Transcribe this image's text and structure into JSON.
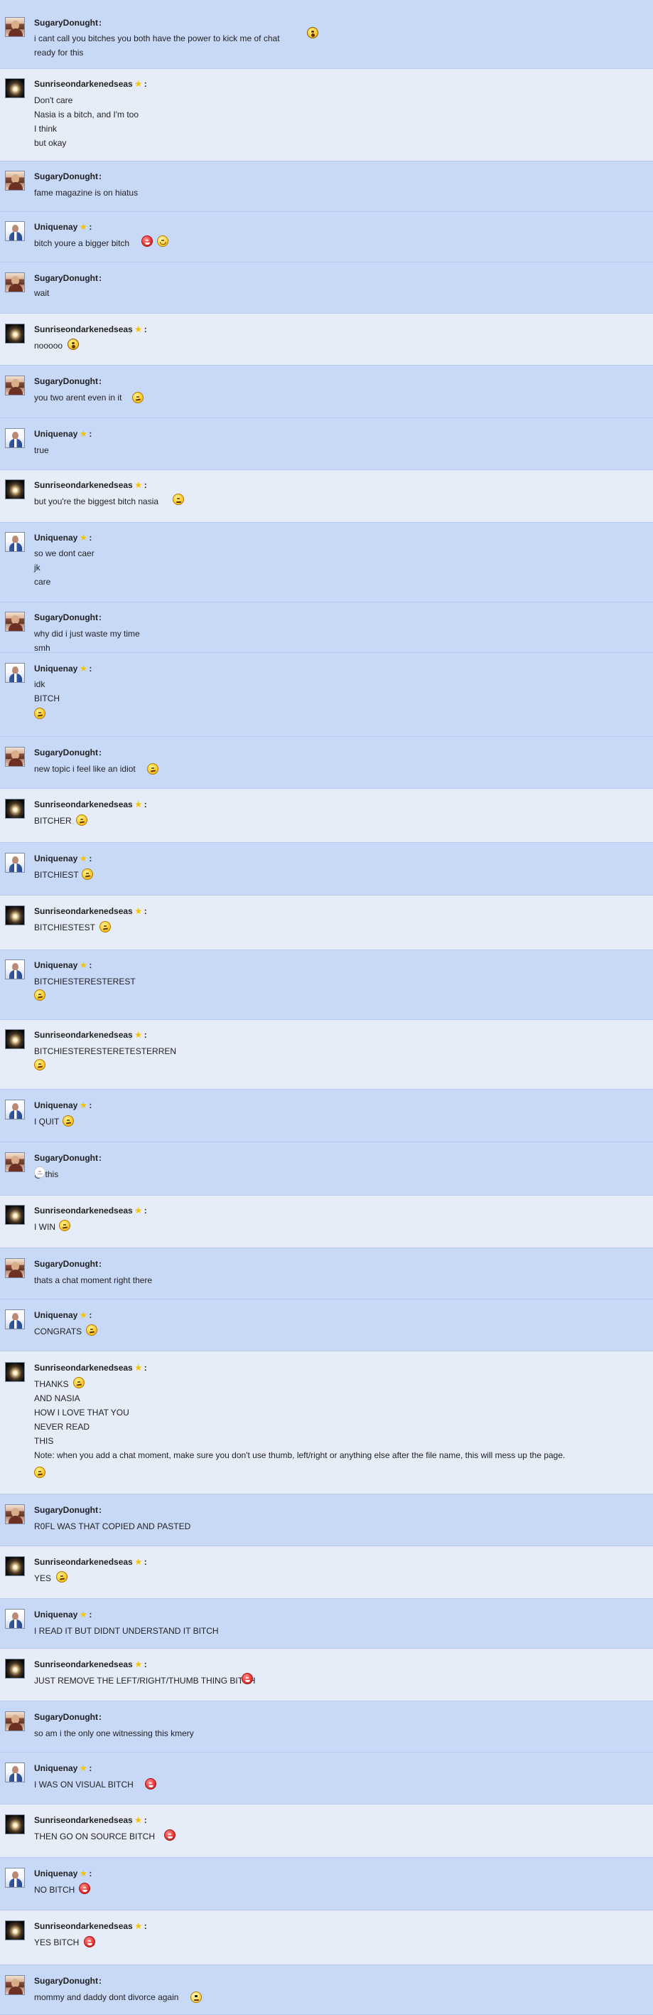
{
  "colors": {
    "blue_row": "#c8d9f8",
    "gray_row": "#e6ecf8",
    "star": "#f5c400",
    "text": "#222222"
  },
  "messages": [
    {
      "user": "SugaryDonught",
      "role": "normal",
      "lines": [
        "i cant call you bitches you both have the power to kick me of chat",
        "ready for this"
      ]
    },
    {
      "user": "Sunriseondarkenedseas",
      "role": "mod",
      "lines": [
        "Don't care",
        "Nasia is a bitch, and I'm too",
        "I think",
        "but okay"
      ]
    },
    {
      "user": "SugaryDonught",
      "role": "normal",
      "lines": [
        "fame magazine is on hiatus"
      ]
    },
    {
      "user": "Uniquenay",
      "role": "mod",
      "lines": [
        "bitch youre a bigger bitch"
      ]
    },
    {
      "user": "SugaryDonught",
      "role": "normal",
      "lines": [
        "wait"
      ]
    },
    {
      "user": "Sunriseondarkenedseas",
      "role": "mod",
      "lines": [
        "nooooo"
      ]
    },
    {
      "user": "SugaryDonught",
      "role": "normal",
      "lines": [
        "you two arent even in it"
      ]
    },
    {
      "user": "Uniquenay",
      "role": "mod",
      "lines": [
        "true"
      ]
    },
    {
      "user": "Sunriseondarkenedseas",
      "role": "mod",
      "lines": [
        "but you're the biggest bitch nasia"
      ]
    },
    {
      "user": "Uniquenay",
      "role": "mod",
      "lines": [
        "so we dont caer",
        "jk",
        "care"
      ]
    },
    {
      "user": "SugaryDonught",
      "role": "normal",
      "lines": [
        "why did i just waste my time",
        "smh"
      ]
    },
    {
      "user": "Uniquenay",
      "role": "mod",
      "lines": [
        "idk",
        "BITCH",
        ""
      ]
    },
    {
      "user": "SugaryDonught",
      "role": "normal",
      "lines": [
        "new topic i feel like an idiot"
      ]
    },
    {
      "user": "Sunriseondarkenedseas",
      "role": "mod",
      "lines": [
        "BITCHER"
      ]
    },
    {
      "user": "Uniquenay",
      "role": "mod",
      "lines": [
        "BITCHIEST"
      ]
    },
    {
      "user": "Sunriseondarkenedseas",
      "role": "mod",
      "lines": [
        "BITCHIESTEST"
      ]
    },
    {
      "user": "Uniquenay",
      "role": "mod",
      "lines": [
        "BITCHIESTERESTEREST",
        ""
      ]
    },
    {
      "user": "Sunriseondarkenedseas",
      "role": "mod",
      "lines": [
        "BITCHIESTERESTERETESTERREN",
        ""
      ]
    },
    {
      "user": "Uniquenay",
      "role": "mod",
      "lines": [
        "I QUIT"
      ]
    },
    {
      "user": "SugaryDonught",
      "role": "normal",
      "lines": [
        "@ this"
      ]
    },
    {
      "user": "Sunriseondarkenedseas",
      "role": "mod",
      "lines": [
        "I WIN"
      ]
    },
    {
      "user": "SugaryDonught",
      "role": "normal",
      "lines": [
        "thats a chat moment right there"
      ]
    },
    {
      "user": "Uniquenay",
      "role": "mod",
      "lines": [
        "CONGRATS"
      ]
    },
    {
      "user": "Sunriseondarkenedseas",
      "role": "mod",
      "lines": [
        "THANKS",
        "AND NASIA",
        "HOW I LOVE THAT YOU",
        "NEVER READ",
        "THIS",
        "Note: when you add a chat moment, make sure you don't use thumb, left/right or anything else after the file name, this will mess up the page.",
        ""
      ]
    },
    {
      "user": "SugaryDonught",
      "role": "normal",
      "lines": [
        "R0FL WAS THAT COPIED AND PASTED"
      ]
    },
    {
      "user": "Sunriseondarkenedseas",
      "role": "mod",
      "lines": [
        "YES"
      ]
    },
    {
      "user": "Uniquenay",
      "role": "mod",
      "lines": [
        "I READ IT BUT DIDNT UNDERSTAND IT BITCH"
      ]
    },
    {
      "user": "Sunriseondarkenedseas",
      "role": "mod",
      "lines": [
        "JUST REMOVE THE LEFT/RIGHT/THUMB THING  BITCH"
      ]
    },
    {
      "user": "SugaryDonught",
      "role": "normal",
      "lines": [
        "so am i the only one witnessing this kmery"
      ]
    },
    {
      "user": "Uniquenay",
      "role": "mod",
      "lines": [
        "I WAS ON VISUAL BITCH"
      ]
    },
    {
      "user": "Sunriseondarkenedseas",
      "role": "mod",
      "lines": [
        "THEN GO ON SOURCE BITCH"
      ]
    },
    {
      "user": "Uniquenay",
      "role": "mod",
      "lines": [
        "NO BITCH"
      ]
    },
    {
      "user": "Sunriseondarkenedseas",
      "role": "mod",
      "lines": [
        "YES BITCH"
      ]
    },
    {
      "user": "SugaryDonught",
      "role": "normal",
      "lines": [
        "mommy and daddy dont divorce again"
      ]
    }
  ]
}
